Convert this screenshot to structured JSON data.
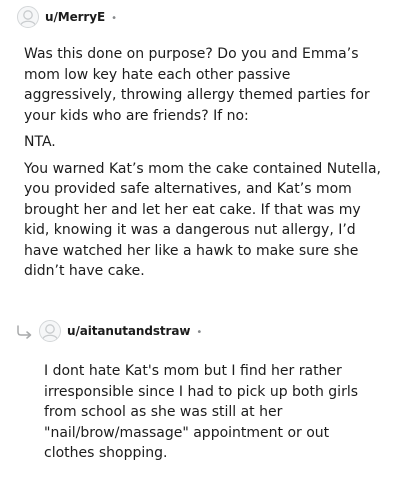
{
  "comment1": {
    "username": "u/MerryE",
    "separator": "•",
    "avatar_icon": "default-avatar-icon",
    "paragraphs": [
      "Was this done on purpose? Do you and Emma’s mom low key hate each other passive aggressively, throwing allergy themed parties for your kids who are friends? If no:",
      "NTA.",
      "You warned Kat’s mom the cake contained Nutella, you provided safe alternatives, and Kat’s mom brought her and let her eat cake. If that was my kid, knowing it was a dangerous nut allergy, I’d have watched her like a hawk to make sure she didn’t have cake."
    ]
  },
  "comment2": {
    "username": "u/aitanutandstraw",
    "separator": "•",
    "avatar_icon": "default-avatar-icon",
    "reply_icon": "reply-arrow-icon",
    "paragraphs": [
      "I dont hate Kat's mom but I find her rather irresponsible since I had to pick up both girls from school as she was still at her \"nail/brow/massage\" appointment or out clothes shopping."
    ]
  }
}
